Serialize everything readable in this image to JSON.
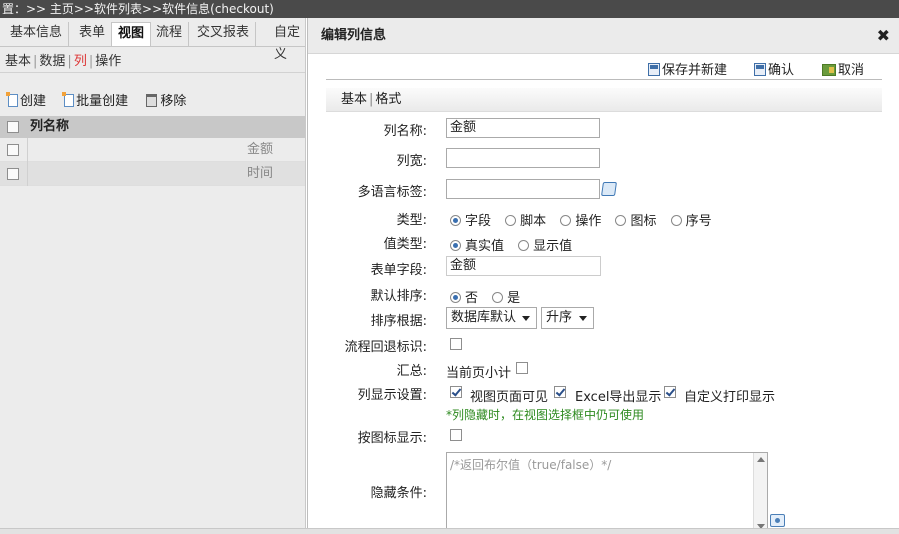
{
  "breadcrumb": "置：>> 主页>>软件列表>>软件信息(checkout)",
  "left": {
    "tabs": [
      "基本信息",
      "表单",
      "视图",
      "流程",
      "交叉报表",
      "自定义"
    ],
    "active_tab": "视图",
    "subtabs": [
      "基本",
      "数据",
      "列",
      "操作"
    ],
    "active_subtab": "列",
    "toolbar": {
      "create": "创建",
      "batch_create": "批量创建",
      "remove": "移除"
    },
    "grid": {
      "header": "列名称",
      "rows": [
        "金额",
        "时间"
      ]
    }
  },
  "dialog": {
    "title": "编辑列信息",
    "close_glyph": "✖",
    "buttons": {
      "save_new": "保存并新建",
      "confirm": "确认",
      "cancel": "取消"
    },
    "form_tabs": [
      "基本",
      "格式"
    ],
    "form": {
      "col_name_label": "列名称:",
      "col_name_value": "金额",
      "col_width_label": "列宽:",
      "col_width_value": "",
      "multilang_label": "多语言标签:",
      "multilang_value": "",
      "type_label": "类型:",
      "type_options": [
        "字段",
        "脚本",
        "操作",
        "图标",
        "序号"
      ],
      "type_selected": "字段",
      "value_type_label": "值类型:",
      "value_type_options": [
        "真实值",
        "显示值"
      ],
      "value_type_selected": "真实值",
      "form_field_label": "表单字段:",
      "form_field_value": "金额",
      "default_sort_label": "默认排序:",
      "default_sort_options": [
        "否",
        "是"
      ],
      "default_sort_selected": "否",
      "sort_by_label": "排序根据:",
      "sort_by_value": "数据库默认",
      "sort_order_value": "升序",
      "flow_back_label": "流程回退标识:",
      "flow_back_checked": false,
      "summary_label": "汇总:",
      "summary_text": "当前页小计",
      "summary_checked": false,
      "display_label": "列显示设置:",
      "display_options": [
        {
          "label": "视图页面可见",
          "checked": true
        },
        {
          "label": "Excel导出显示",
          "checked": true
        },
        {
          "label": "自定义打印显示",
          "checked": true
        }
      ],
      "hint": "*列隐藏时，在视图选择框中仍可使用",
      "icon_display_label": "按图标显示:",
      "icon_display_checked": false,
      "hidden_cond_label": "隐藏条件:",
      "hidden_cond_placeholder": "/*返回布尔值（true/false）*/"
    }
  }
}
